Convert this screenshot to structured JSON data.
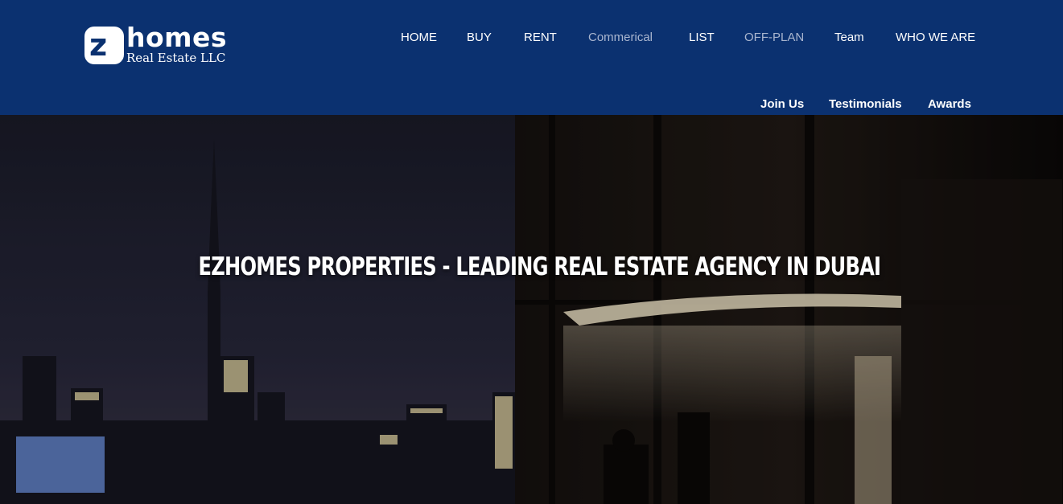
{
  "logo": {
    "mark_letter": "z",
    "wordmark": "homes",
    "subtitle": "Real Estate LLC"
  },
  "nav": {
    "main": [
      {
        "label": "HOME",
        "active": true
      },
      {
        "label": "BUY",
        "active": true
      },
      {
        "label": "RENT",
        "active": true
      },
      {
        "label": "Commerical",
        "active": false
      },
      {
        "label": "LIST",
        "active": true
      },
      {
        "label": "OFF-PLAN",
        "active": false
      },
      {
        "label": "Team",
        "active": true
      },
      {
        "label": "WHO WE ARE",
        "active": true
      }
    ],
    "sub": [
      {
        "label": "Join Us"
      },
      {
        "label": "Testimonials"
      },
      {
        "label": "Awards"
      }
    ]
  },
  "hero": {
    "title": "EZHOMES PROPERTIES - LEADING REAL ESTATE AGENCY IN DUBAI"
  },
  "colors": {
    "header_bg": "#0b3170",
    "nav_text": "#ffffff",
    "nav_muted": "#aab6cf"
  }
}
